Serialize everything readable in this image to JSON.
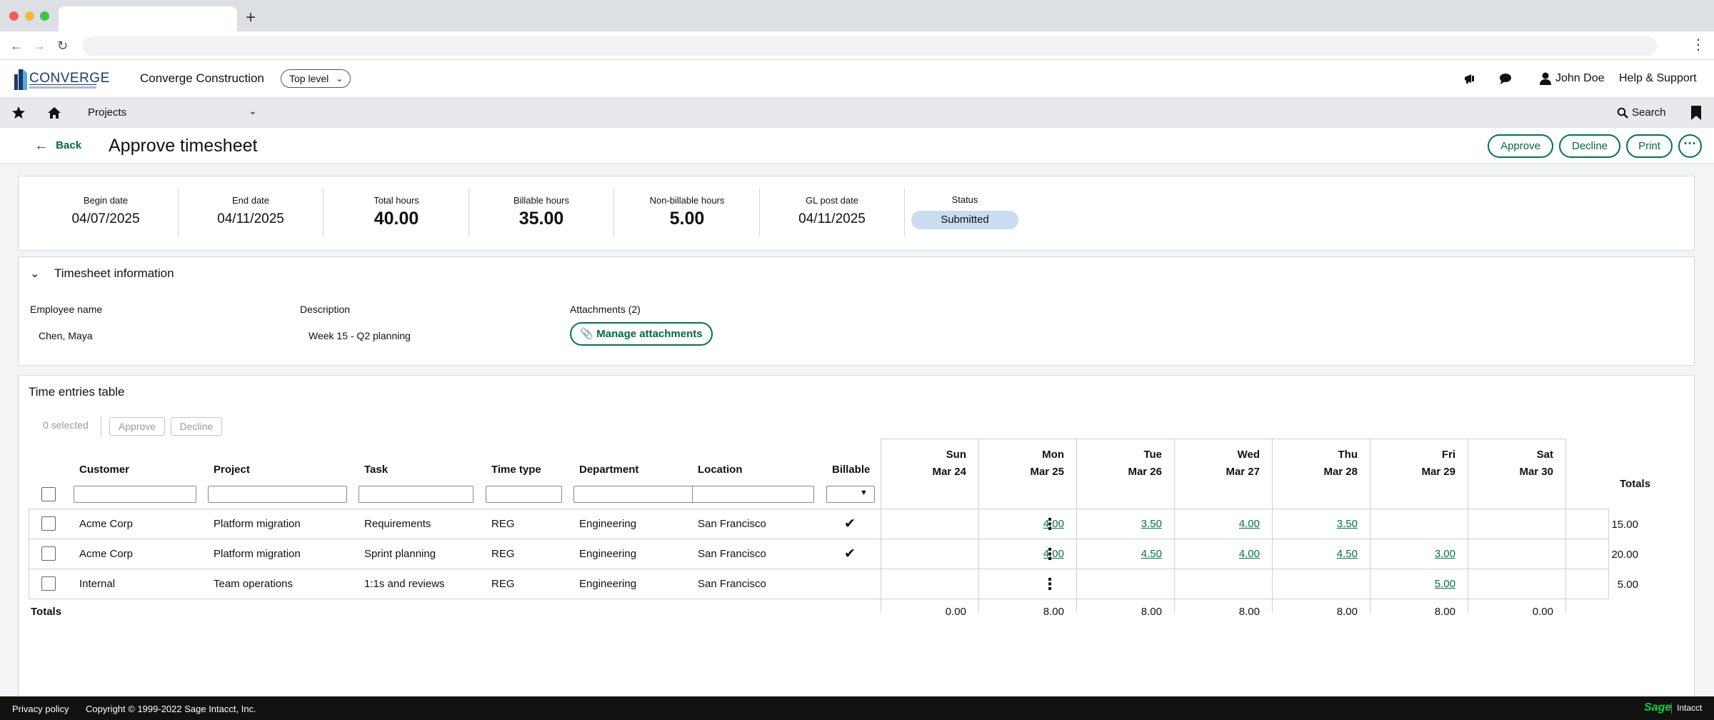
{
  "browser": {
    "new_tab": "+"
  },
  "header": {
    "company": "Converge Construction",
    "entity": "Top level",
    "user": "John Doe",
    "help": "Help & Support"
  },
  "nav": {
    "module": "Projects",
    "search": "Search"
  },
  "page": {
    "back": "Back",
    "title": "Approve timesheet",
    "actions": {
      "approve": "Approve",
      "decline": "Decline",
      "print": "Print",
      "more": "···"
    }
  },
  "summary": [
    {
      "label": "Begin date",
      "value": "04/07/2025",
      "big": false
    },
    {
      "label": "End date",
      "value": "04/11/2025",
      "big": false
    },
    {
      "label": "Total hours",
      "value": "40.00",
      "big": true
    },
    {
      "label": "Billable hours",
      "value": "35.00",
      "big": true
    },
    {
      "label": "Non-billable hours",
      "value": "5.00",
      "big": true
    },
    {
      "label": "GL post date",
      "value": "04/11/2025",
      "big": false
    }
  ],
  "status": {
    "label": "Status",
    "value": "Submitted",
    "color": "#c9dcf0"
  },
  "info": {
    "title": "Timesheet information",
    "employee_label": "Employee name",
    "employee": "Chen, Maya",
    "description_label": "Description",
    "description": "Week 15 - Q2 planning",
    "attachments_label": "Attachments (2)",
    "manage": "Manage attachments"
  },
  "entries": {
    "title": "Time entries table",
    "selected": "0 selected",
    "approve": "Approve",
    "decline": "Decline",
    "columns": [
      "Customer",
      "Project",
      "Task",
      "Time type",
      "Department",
      "Location",
      "Billable"
    ],
    "days": [
      {
        "dow": "Sun",
        "date": "Mar 24"
      },
      {
        "dow": "Mon",
        "date": "Mar 25"
      },
      {
        "dow": "Tue",
        "date": "Mar 26"
      },
      {
        "dow": "Wed",
        "date": "Mar 27"
      },
      {
        "dow": "Thu",
        "date": "Mar 28"
      },
      {
        "dow": "Fri",
        "date": "Mar 29"
      },
      {
        "dow": "Sat",
        "date": "Mar 30"
      }
    ],
    "totals_header": "Totals",
    "rows": [
      {
        "customer": "Acme Corp",
        "project": "Platform migration",
        "task": "Requirements",
        "time_type": "REG",
        "department": "Engineering",
        "location": "San Francisco",
        "billable": "✔",
        "hours": [
          "",
          "4.00",
          "3.50",
          "4.00",
          "3.50",
          "",
          ""
        ],
        "total": "15.00"
      },
      {
        "customer": "Acme Corp",
        "project": "Platform migration",
        "task": "Sprint planning",
        "time_type": "REG",
        "department": "Engineering",
        "location": "San Francisco",
        "billable": "✔",
        "hours": [
          "",
          "4.00",
          "4.50",
          "4.00",
          "4.50",
          "3.00",
          ""
        ],
        "total": "20.00"
      },
      {
        "customer": "Internal",
        "project": "Team operations",
        "task": "1:1s and reviews",
        "time_type": "REG",
        "department": "Engineering",
        "location": "San Francisco",
        "billable": "",
        "hours": [
          "",
          "",
          "",
          "",
          "",
          "5.00",
          ""
        ],
        "total": "5.00"
      }
    ],
    "totals_label": "Totals",
    "day_totals": [
      "0.00",
      "8.00",
      "8.00",
      "8.00",
      "8.00",
      "8.00",
      "0.00"
    ]
  },
  "footer": {
    "privacy": "Privacy policy",
    "copyright": "Copyright © 1999-2022 Sage Intacct, Inc.",
    "sage": "Sage",
    "intacct": "Intacct"
  }
}
